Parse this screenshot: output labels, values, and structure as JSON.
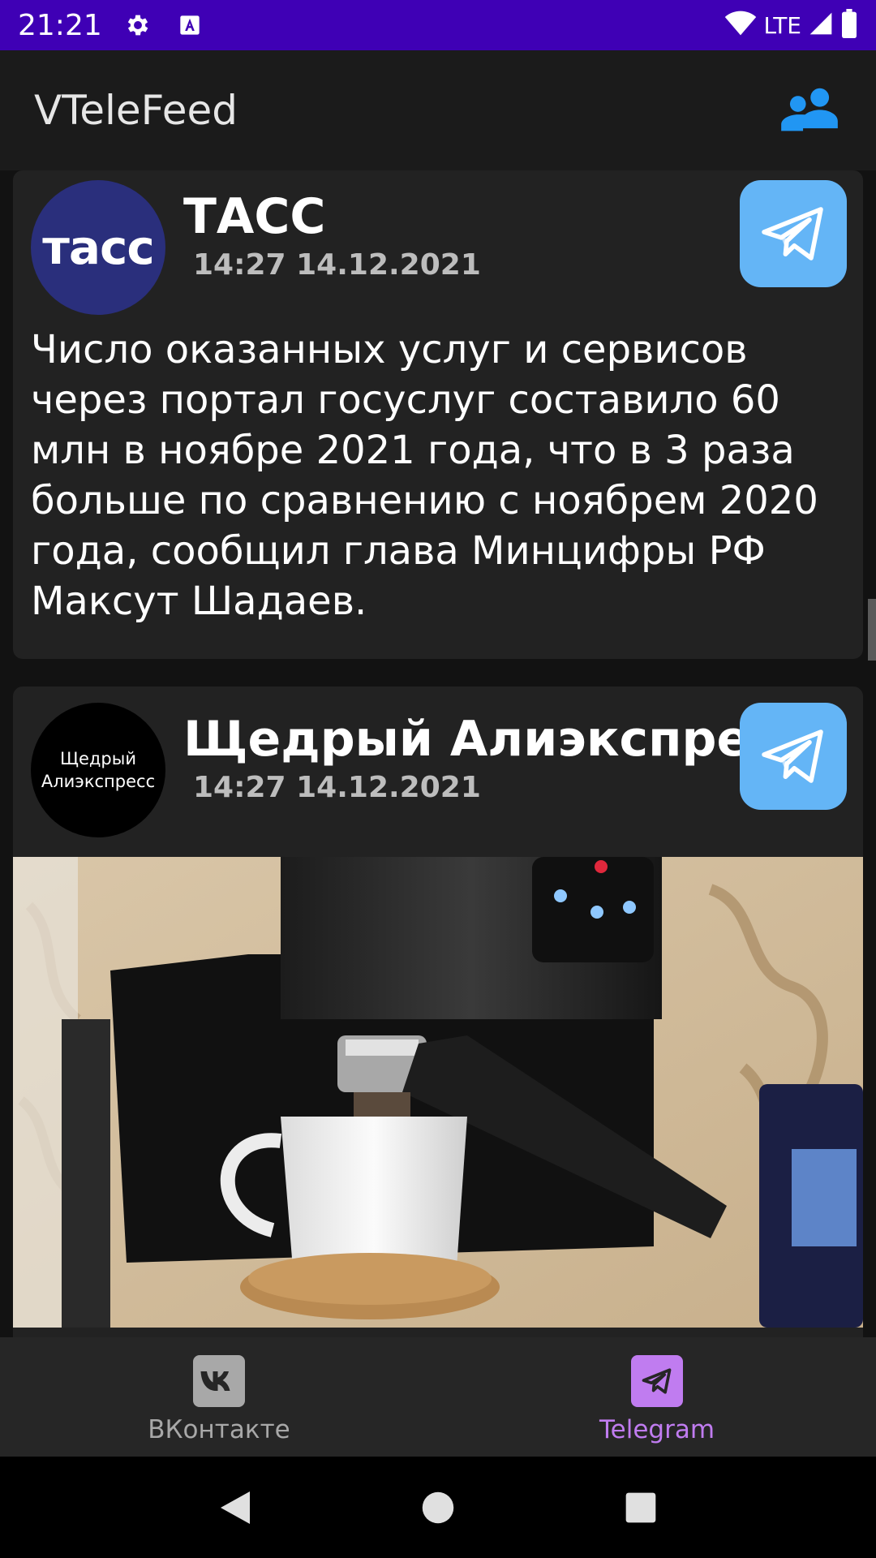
{
  "status_bar": {
    "time": "21:21",
    "network": "LTE"
  },
  "app_bar": {
    "title": "VTeleFeed",
    "action_icon": "group-icon"
  },
  "posts": [
    {
      "channel": "ТАСС",
      "avatar_text": "тасс",
      "date": "14:27 14.12.2021",
      "text": "Число оказанных услуг и сервисов через портал госуслуг составило 60 млн в ноябре 2021 года, что в 3 раза больше по сравнению с ноябрем 2020 года, сообщил глава Минцифры РФ Максут Шадаев."
    },
    {
      "channel": "Щедрый Алиэкспресс",
      "avatar_text_line1": "Щедрый",
      "avatar_text_line2": "Алиэкспресс",
      "date": "14:27 14.12.2021",
      "image": "coffee-machine-photo"
    }
  ],
  "bottom_nav": {
    "items": [
      {
        "label": "ВКонтакте",
        "icon": "vk-icon",
        "active": false
      },
      {
        "label": "Telegram",
        "icon": "telegram-icon",
        "active": true
      }
    ],
    "active_color": "#c07cf0",
    "inactive_color": "#a8a8a8"
  },
  "colors": {
    "status_bar": "#3f00b5",
    "telegram_button": "#64b5f6",
    "tass_avatar": "#2a2f7c",
    "group_icon": "#2196f3"
  }
}
